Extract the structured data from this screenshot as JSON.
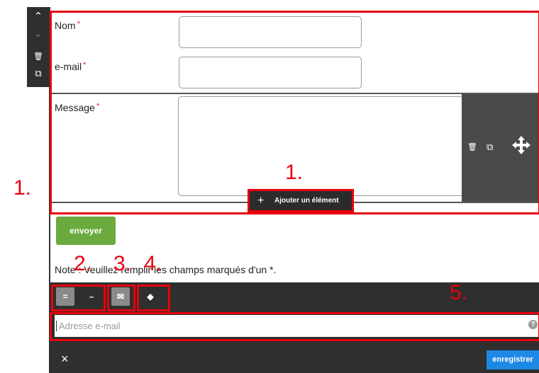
{
  "toolbar_left": {
    "up": "⌃",
    "down": "⌄",
    "delete": "🗑",
    "copy": "⧉"
  },
  "form": {
    "name_label": "Nom",
    "email_label": "e-mail",
    "message_label": "Message",
    "required_mark": "*",
    "add_element_label": "Ajouter un élément",
    "add_plus": "+",
    "submit_label": "envoyer",
    "note": "Note : Veuillez remplir les champs marqués d'un *."
  },
  "annotations": {
    "n1a": "1.",
    "n1b": "1.",
    "n2": "2.",
    "n3": "3.",
    "n4": "4.",
    "n5": "5."
  },
  "tabs": {
    "t2a": "=",
    "t2b": "–",
    "t3": "✉",
    "t4": "◆"
  },
  "email_input": {
    "placeholder": "Adresse e-mail",
    "help": "?"
  },
  "footer": {
    "close": "×",
    "save": "enregistrer"
  },
  "colors": {
    "annotation": "#e8000d",
    "submit": "#6aaa3f",
    "save": "#1e88e5",
    "dark": "#2f2f2f"
  }
}
